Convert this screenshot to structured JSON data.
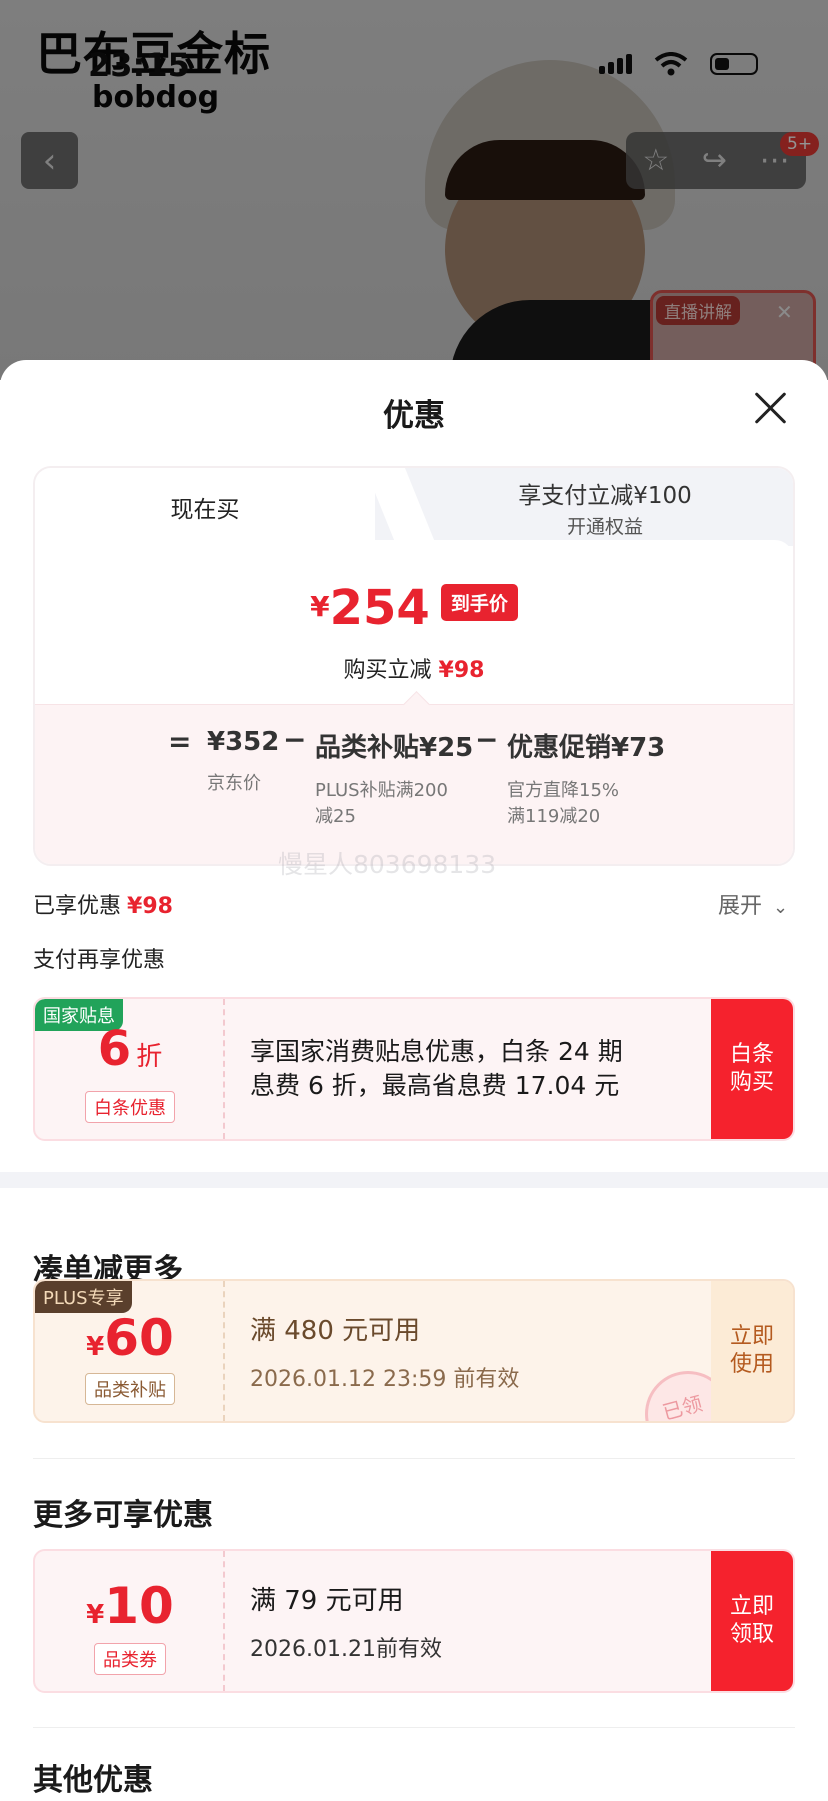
{
  "background": {
    "brand_cn": "巴布豆金标",
    "brand_en": "bobdog",
    "clock": "23:15",
    "badge_count": "5+",
    "live_label": "直播讲解"
  },
  "sheet": {
    "title": "优惠",
    "tabs": {
      "now": "现在买",
      "pay_line1": "享支付立减¥100",
      "pay_line2": "开通权益"
    },
    "price": {
      "currency": "¥",
      "final": "254",
      "final_tag": "到手价",
      "buy_off_label": "购买立减",
      "buy_off_value": "¥98"
    },
    "breakdown": {
      "eq": "=",
      "jd_price": "¥352",
      "jd_label": "京东价",
      "minus": "−",
      "cat_subsidy": "品类补贴¥25",
      "cat_sub_line1": "PLUS补贴满200",
      "cat_sub_line2": "减25",
      "promo": "优惠促销¥73",
      "promo_line1": "官方直降15%",
      "promo_line2": "满119减20"
    },
    "watermark": "慢星人803698133",
    "enjoyed_label": "已享优惠",
    "enjoyed_value": "¥98",
    "expand_label": "展开",
    "pay_more_label": "支付再享优惠",
    "coupon_national": {
      "tag": "国家贴息",
      "value": "6",
      "unit": "折",
      "sub": "白条优惠",
      "desc_line1": "享国家消费贴息优惠，白条 24 期",
      "desc_line2": "息费 6 折，最高省息费 17.04 元",
      "btn_line1": "白条",
      "btn_line2": "购买"
    },
    "section_more": "凑单减更多",
    "coupon_plus": {
      "tag": "PLUS专享",
      "currency": "¥",
      "value": "60",
      "sub": "品类补贴",
      "desc_line1": "满 480 元可用",
      "desc_line2": "2026.01.12 23:59 前有效",
      "btn_line1": "立即",
      "btn_line2": "使用",
      "stamp": "已领"
    },
    "section_more_enjoy": "更多可享优惠",
    "coupon_cat": {
      "currency": "¥",
      "value": "10",
      "sub": "品类券",
      "desc_line1": "满 79 元可用",
      "desc_line2": "2026.01.21前有效",
      "btn_line1": "立即",
      "btn_line2": "领取"
    },
    "section_other": "其他优惠"
  },
  "colors": {
    "accent_red": "#e8232f",
    "button_red": "#f5222d",
    "gold_text": "#b45a1f"
  }
}
